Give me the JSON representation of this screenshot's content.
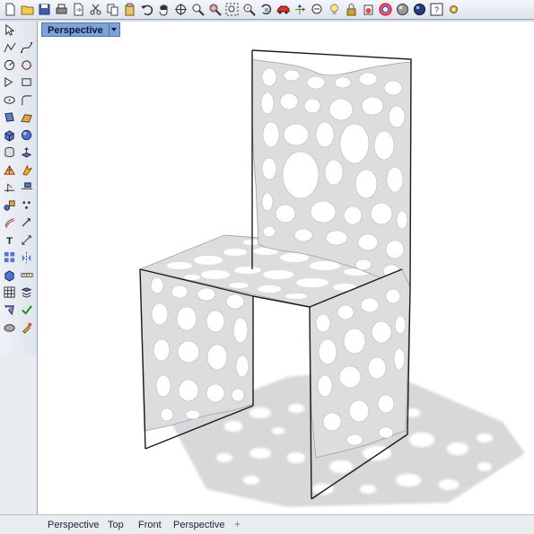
{
  "toolbar": {
    "icons": [
      "new-icon",
      "open-icon",
      "save-icon",
      "print-icon",
      "import-icon",
      "cut-icon",
      "copy-icon",
      "paste-icon",
      "undo-icon",
      "pan-icon",
      "rotate-view-icon",
      "zoom-icon",
      "zoom-window-icon",
      "zoom-extents-icon",
      "zoom-selected-icon",
      "undo-view-icon",
      "car-icon",
      "gumball-icon",
      "named-view-icon",
      "light-icon",
      "lock-icon",
      "material-icon",
      "color-icon",
      "shade-icon",
      "render-icon",
      "help-icon",
      "gear-icon"
    ]
  },
  "left_toolbar": {
    "icons": [
      [
        "select-icon"
      ],
      [
        "polyline-icon",
        "curve-icon"
      ],
      [
        "circle-icon",
        "circle-3pt-icon"
      ],
      [
        "arc-icon",
        "rectangle-icon"
      ],
      [
        "ellipse-icon",
        "fillet-curve-icon"
      ],
      [
        "surface-icon",
        "loft-icon"
      ],
      [
        "box-icon",
        "sphere-icon"
      ],
      [
        "cylinder-icon",
        "extrude-icon"
      ],
      [
        "mesh-icon",
        "boolean-icon"
      ],
      [
        "trim-icon",
        "split-icon"
      ],
      [
        "group-icon",
        "dots-icon"
      ],
      [
        "offset-icon",
        "arrow-icon"
      ],
      [
        "text-icon",
        "dimension-icon"
      ],
      [
        "array-icon",
        "mirror-icon"
      ],
      [
        "block-icon",
        "ruler-icon"
      ],
      [
        "grid-icon",
        "layer-icon"
      ],
      [
        "analyze-icon",
        "check-icon"
      ],
      [
        "solid-icon",
        "paint-icon"
      ]
    ]
  },
  "viewport": {
    "tab_label": "Perspective",
    "background": "#ffffff"
  },
  "bottom_tabs": [
    "Perspective",
    "Top",
    "Front",
    "Perspective"
  ],
  "bottom_add": "+",
  "colors": {
    "accent": "#7ea3d6",
    "chair": "#d9dadc",
    "shadow": "#c5c6c8",
    "frame": "#1a1a1a"
  }
}
